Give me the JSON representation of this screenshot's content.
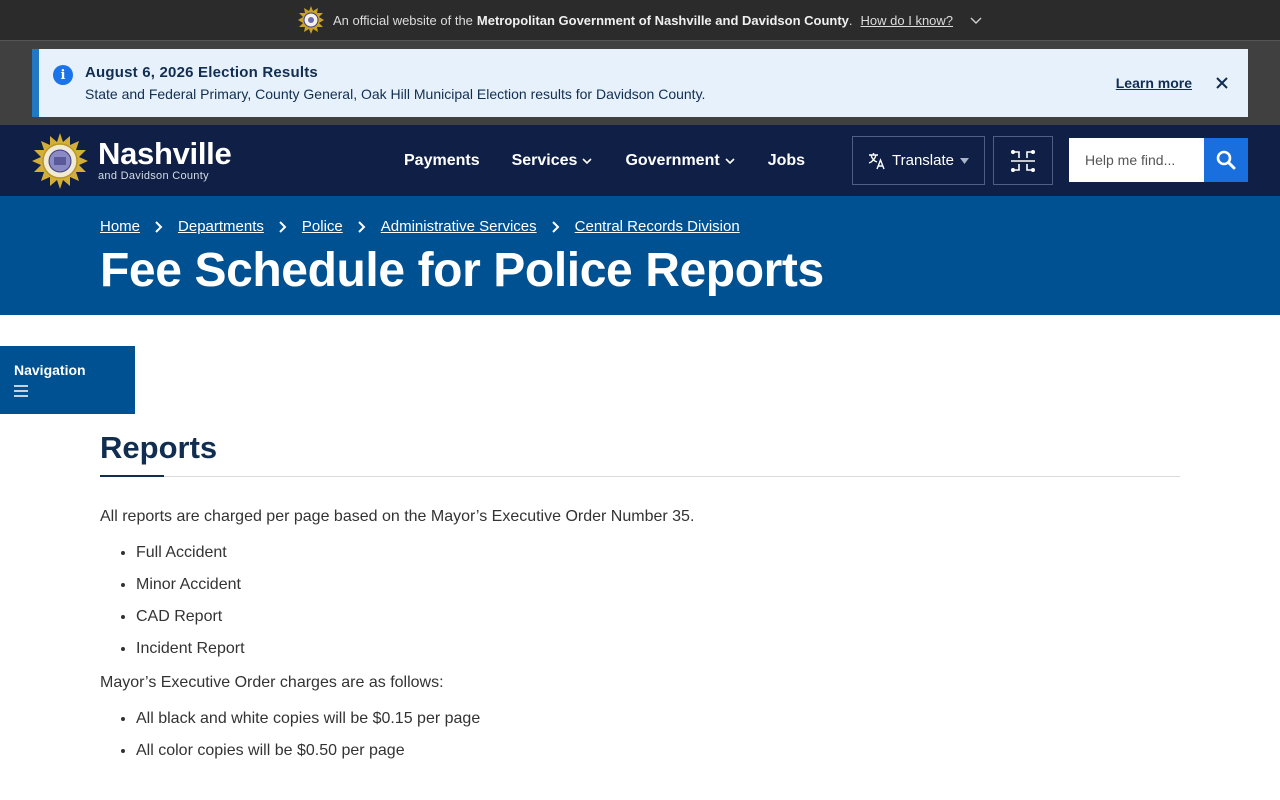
{
  "official_banner": {
    "prefix": "An official website of the",
    "org": "Metropolitan Government of Nashville and Davidson County",
    "period": ".",
    "link": "How do I know?"
  },
  "alert": {
    "title": "August 6, 2026 Election Results",
    "body": "State and Federal Primary, County General, Oak Hill Municipal Election results for Davidson County.",
    "learn_more": "Learn more"
  },
  "header": {
    "logo_name": "Nashville",
    "logo_sub": "and Davidson County",
    "nav": [
      {
        "label": "Payments"
      },
      {
        "label": "Services"
      },
      {
        "label": "Government"
      },
      {
        "label": "Jobs"
      }
    ],
    "translate": "Translate",
    "search_placeholder": "Help me find..."
  },
  "breadcrumbs": [
    "Home",
    "Departments",
    "Police",
    "Administrative Services",
    "Central Records Division"
  ],
  "page_title": "Fee Schedule for Police Reports",
  "side_nav_label": "Navigation",
  "content": {
    "heading": "Reports",
    "intro": "All reports are charged per page based on the Mayor’s Executive Order Number 35.",
    "report_types": [
      "Full Accident",
      "Minor Accident",
      "CAD Report",
      "Incident Report"
    ],
    "charges_intro": "Mayor’s Executive Order charges are as follows:",
    "charges": [
      "All black and white copies will be $0.15 per page",
      "All color copies will be $0.50 per page"
    ]
  },
  "colors": {
    "header_bg": "#0f1f45",
    "hero_bg": "#005191",
    "alert_bg": "#e7f1fb",
    "accent_blue": "#1a6fde"
  }
}
